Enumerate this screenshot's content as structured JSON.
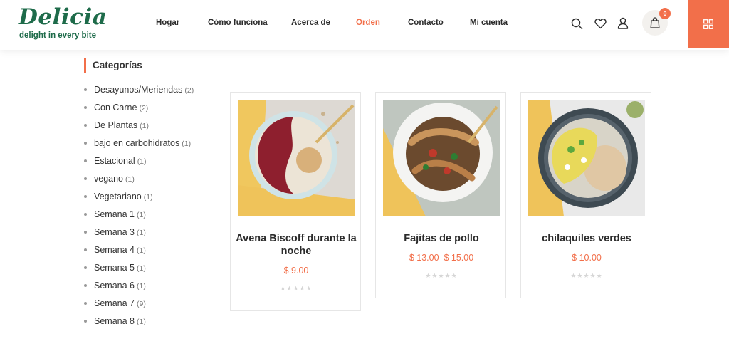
{
  "brand": {
    "name": "Delicia",
    "tagline": "delight in every bite",
    "color": "#1e6b4a"
  },
  "accent_color": "#f26f4a",
  "nav": {
    "items": [
      {
        "label": "Hogar"
      },
      {
        "label": "Cómo funciona"
      },
      {
        "label": "Acerca de"
      },
      {
        "label": "Orden",
        "active": true
      },
      {
        "label": "Contacto"
      },
      {
        "label": "Mi cuenta"
      }
    ]
  },
  "header_icons": [
    "search-icon",
    "heart-icon",
    "user-icon",
    "bag-icon",
    "grid-icon"
  ],
  "cart": {
    "count": "0"
  },
  "sidebar": {
    "title": "Categorías",
    "categories": [
      {
        "label": "Desayunos/Meriendas",
        "count": "(2)"
      },
      {
        "label": "Con Carne",
        "count": "(2)"
      },
      {
        "label": "De Plantas",
        "count": "(1)"
      },
      {
        "label": "bajo en carbohidratos",
        "count": "(1)"
      },
      {
        "label": "Estacional",
        "count": "(1)"
      },
      {
        "label": "vegano",
        "count": "(1)"
      },
      {
        "label": "Vegetariano",
        "count": "(1)"
      },
      {
        "label": "Semana 1",
        "count": "(1)"
      },
      {
        "label": "Semana 3",
        "count": "(1)"
      },
      {
        "label": "Semana 4",
        "count": "(1)"
      },
      {
        "label": "Semana 5",
        "count": "(1)"
      },
      {
        "label": "Semana 6",
        "count": "(1)"
      },
      {
        "label": "Semana 7",
        "count": "(9)"
      },
      {
        "label": "Semana 8",
        "count": "(1)"
      }
    ]
  },
  "products": [
    {
      "title": "Avena Biscoff durante la noche",
      "price": "$ 9.00",
      "rating": 0,
      "stars": "★★★★★"
    },
    {
      "title": "Fajitas de pollo",
      "price": "$ 13.00–$ 15.00",
      "rating": 0,
      "stars": "★★★★★"
    },
    {
      "title": "chilaquiles verdes",
      "price": "$ 10.00",
      "rating": 0,
      "stars": "★★★★★"
    }
  ]
}
